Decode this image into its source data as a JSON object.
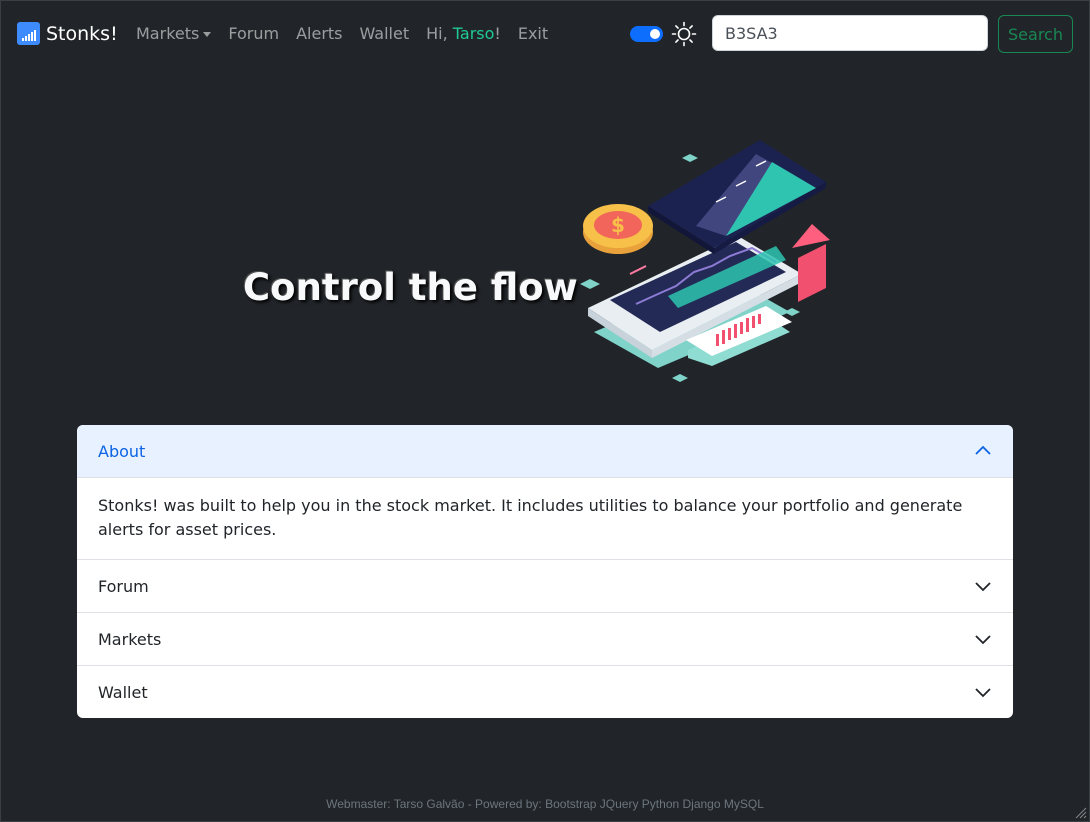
{
  "navbar": {
    "brand": "Stonks!",
    "links": {
      "markets": "Markets",
      "forum": "Forum",
      "alerts": "Alerts",
      "wallet": "Wallet",
      "greeting_prefix": "Hi, ",
      "username": "Tarso",
      "greeting_suffix": "!",
      "exit": "Exit"
    },
    "theme_toggle": {
      "state": "on",
      "icon": "sun-icon"
    },
    "search": {
      "value": "B3SA3",
      "button": "Search"
    }
  },
  "hero": {
    "title": "Control the flow",
    "illustration": "stock-market-phone-illustration"
  },
  "accordion": {
    "items": [
      {
        "title": "About",
        "expanded": true,
        "body": "Stonks! was built to help you in the stock market. It includes utilities to balance your portfolio and generate alerts for asset prices."
      },
      {
        "title": "Forum",
        "expanded": false
      },
      {
        "title": "Markets",
        "expanded": false
      },
      {
        "title": "Wallet",
        "expanded": false
      }
    ]
  },
  "footer": {
    "text": "Webmaster: Tarso Galvão - Powered by: Bootstrap JQuery Python Django MySQL"
  },
  "colors": {
    "background": "#212529",
    "accent": "#0d6efd",
    "success": "#198754",
    "username": "#20c997",
    "accordion_active_bg": "#e7f1ff"
  }
}
